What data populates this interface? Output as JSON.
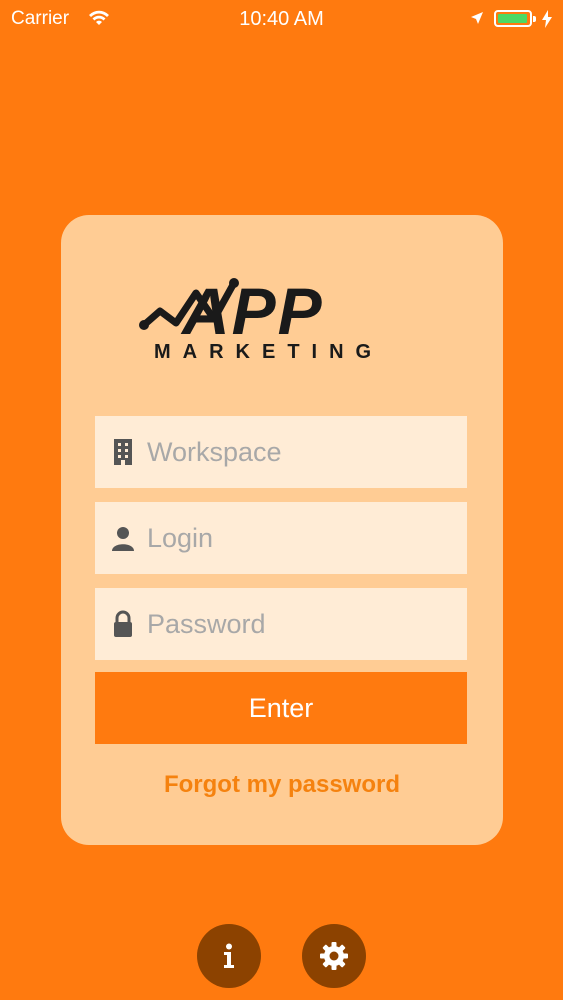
{
  "status_bar": {
    "carrier": "Carrier",
    "time": "10:40 AM",
    "battery_color": "#4cd964"
  },
  "logo": {
    "app_text": "APP",
    "subtitle": "MARKETING"
  },
  "form": {
    "workspace": {
      "placeholder": "Workspace",
      "value": "",
      "icon": "building-icon"
    },
    "login": {
      "placeholder": "Login",
      "value": "",
      "icon": "user-icon"
    },
    "password": {
      "placeholder": "Password",
      "value": "",
      "icon": "lock-icon"
    },
    "enter_label": "Enter",
    "forgot_label": "Forgot my password"
  },
  "footer": {
    "info_icon": "info-icon",
    "settings_icon": "gear-icon"
  },
  "colors": {
    "background": "#ff7a0f",
    "card": "#ffcc94",
    "field": "#ffecd6",
    "button": "#ff7a0f",
    "link": "#f5820f",
    "round_button": "#8c4200"
  }
}
